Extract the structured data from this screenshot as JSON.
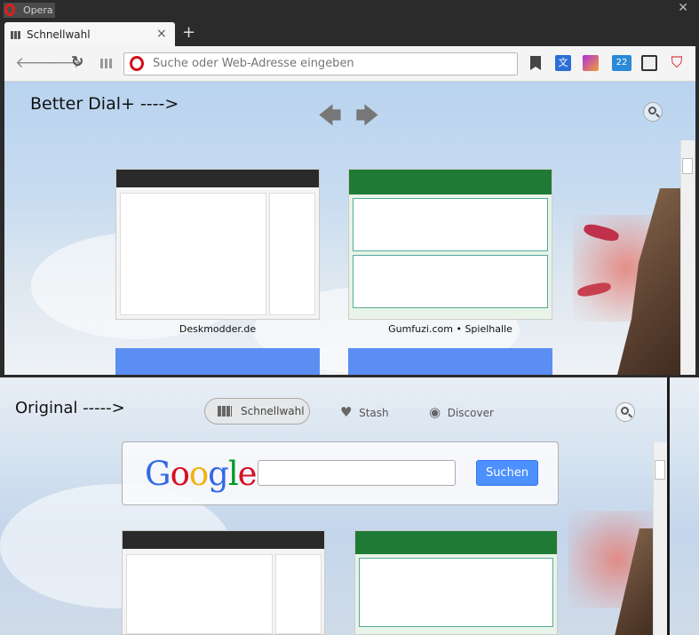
{
  "top": {
    "window_title": "Opera",
    "tab": {
      "label": "Schnellwahl",
      "close": "×"
    },
    "new_tab": "+",
    "url_placeholder": "Suche oder Web-Adresse eingeben",
    "annotation": "Better Dial+ ---->",
    "dials": [
      {
        "label": "Deskmodder.de"
      },
      {
        "label": "Gumfuzi.com • Spielhalle"
      }
    ]
  },
  "bottom": {
    "annotation": "Original ----->",
    "nav": [
      {
        "label": "Schnellwahl",
        "icon": "grid-icon"
      },
      {
        "label": "Stash",
        "icon": "heart-icon"
      },
      {
        "label": "Discover",
        "icon": "eye-icon"
      }
    ],
    "google": {
      "logo": "Google",
      "button": "Suchen"
    }
  },
  "colors": {
    "dial_blue": "#5b8ef2",
    "google_button": "#4d90fe",
    "opera_red": "#d5101a"
  }
}
